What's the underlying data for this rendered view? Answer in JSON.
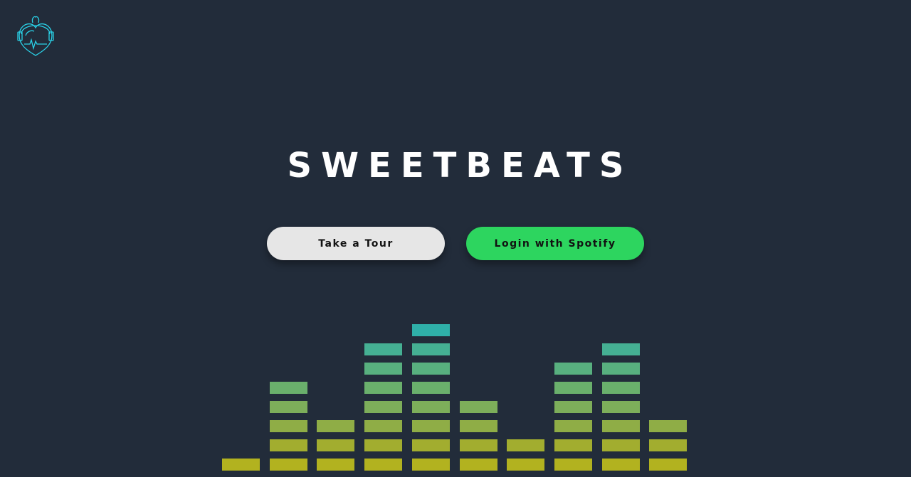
{
  "app": {
    "title": "SWEETBEATS"
  },
  "buttons": {
    "tour_label": "Take a Tour",
    "spotify_label": "Login with Spotify"
  },
  "logo": {
    "icon": "heart-headphones-icon",
    "color": "#2ad2e8"
  },
  "equalizer": {
    "levels": [
      1,
      5,
      3,
      7,
      8,
      4,
      2,
      6,
      7,
      3
    ],
    "colors": [
      "#b2b21f",
      "#a2ad2f",
      "#8fad46",
      "#7dae5a",
      "#6ab06c",
      "#58b07f",
      "#45b093",
      "#2fb0a9",
      "#1fb0c3"
    ]
  },
  "theme": {
    "background": "#222c3a",
    "tour_button": "#e6e6e6",
    "spotify_button": "#2dd55f"
  }
}
